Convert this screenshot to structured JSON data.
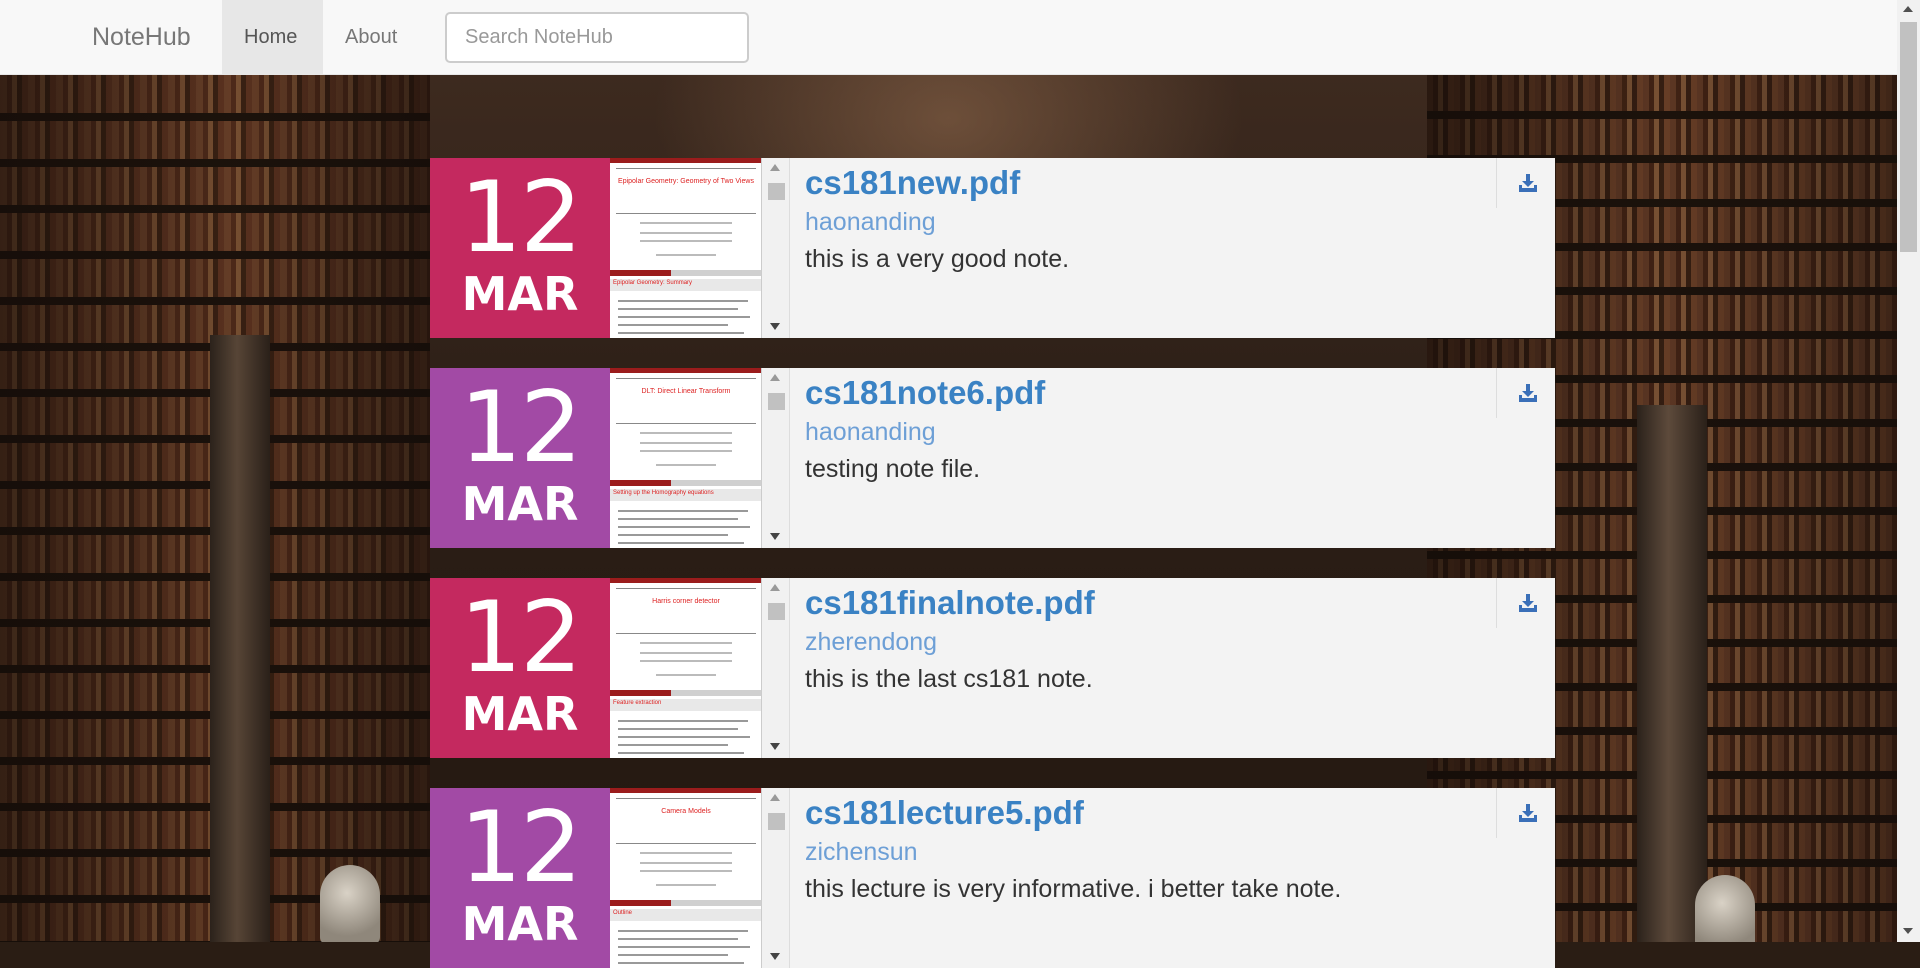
{
  "navbar": {
    "brand": "NoteHub",
    "links": [
      {
        "label": "Home",
        "active": true
      },
      {
        "label": "About",
        "active": false
      }
    ],
    "search_placeholder": "Search NoteHub",
    "search_value": ""
  },
  "notes": [
    {
      "day": "12",
      "month": "MAR",
      "date_color": "#c4295f",
      "title": "cs181new.pdf",
      "author": "haonanding",
      "description": "this is a very good note.",
      "preview_title": "Epipolar Geometry: Geometry of Two Views",
      "preview_section": "Epipolar Geometry: Summary"
    },
    {
      "day": "12",
      "month": "MAR",
      "date_color": "#a24aa5",
      "title": "cs181note6.pdf",
      "author": "haonanding",
      "description": "testing note file.",
      "preview_title": "DLT: Direct Linear Transform",
      "preview_section": "Setting up the Homography equations"
    },
    {
      "day": "12",
      "month": "MAR",
      "date_color": "#c4295f",
      "title": "cs181finalnote.pdf",
      "author": "zherendong",
      "description": "this is the last cs181 note.",
      "preview_title": "Harris corner detector",
      "preview_section": "Feature extraction"
    },
    {
      "day": "12",
      "month": "MAR",
      "date_color": "#a24aa5",
      "title": "cs181lecture5.pdf",
      "author": "zichensun",
      "description": "this lecture is very informative. i better take note.",
      "preview_title": "Camera Models",
      "preview_section": "Outline"
    }
  ],
  "colors": {
    "link_blue": "#3a82c4",
    "author_blue": "#6d9fd6",
    "navbar_bg": "#f8f8f8"
  },
  "icons": {
    "download": "download-icon"
  }
}
